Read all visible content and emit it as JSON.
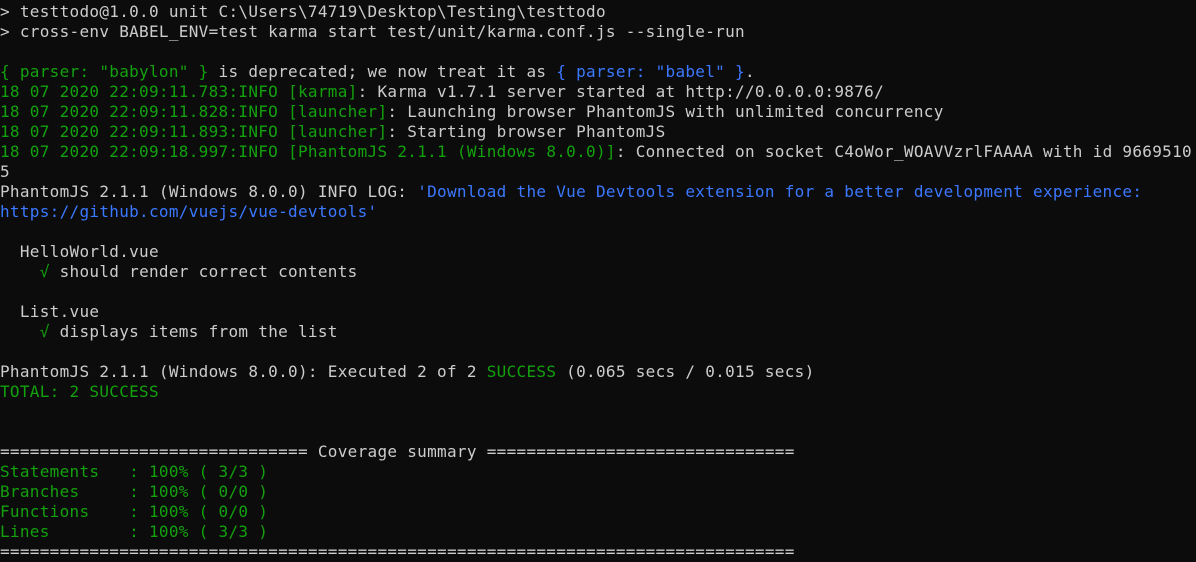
{
  "colors": {
    "background": "#0c0c0c",
    "text": "#cccccc",
    "green": "#13a10e",
    "blue": "#3b78ff"
  },
  "prompt": {
    "line1": "> testtodo@1.0.0 unit C:\\Users\\74719\\Desktop\\Testing\\testtodo",
    "line2": "> cross-env BABEL_ENV=test karma start test/unit/karma.conf.js --single-run"
  },
  "deprecation": {
    "open_brace": "{ parser: \"babylon\" }",
    "middle": " is deprecated; we now treat it as ",
    "new_value": "{ parser: \"babel\" }",
    "end": "."
  },
  "karma_logs": [
    {
      "timestamp": "18 07 2020 22:09:11.783:INFO ",
      "tag": "[karma]",
      "message": ": Karma v1.7.1 server started at http://0.0.0.0:9876/"
    },
    {
      "timestamp": "18 07 2020 22:09:11.828:INFO ",
      "tag": "[launcher]",
      "message": ": Launching browser PhantomJS with unlimited concurrency"
    },
    {
      "timestamp": "18 07 2020 22:09:11.893:INFO ",
      "tag": "[launcher]",
      "message": ": Starting browser PhantomJS"
    },
    {
      "timestamp": "18 07 2020 22:09:18.997:INFO ",
      "tag": "[PhantomJS 2.1.1 (Windows 8.0.0)]",
      "message": ": Connected on socket C4oWor_WOAVVzrlFAAAA with id 9669510"
    }
  ],
  "wrapped_id_tail": "5",
  "info_log": {
    "prefix": "PhantomJS 2.1.1 (Windows 8.0.0) INFO LOG: ",
    "message_part1": "'Download the Vue Devtools extension for a better development experience:",
    "message_part2": "https://github.com/vuejs/vue-devtools'"
  },
  "suites": [
    {
      "name": "  HelloWorld.vue",
      "check": "    √",
      "test": " should render correct contents"
    },
    {
      "name": "  List.vue",
      "check": "    √",
      "test": " displays items from the list"
    }
  ],
  "execution": {
    "prefix": "PhantomJS 2.1.1 (Windows 8.0.0): Executed 2 of 2 ",
    "status": "SUCCESS",
    "timing": " (0.065 secs / 0.015 secs)",
    "total": "TOTAL: 2 SUCCESS"
  },
  "coverage": {
    "header": "=============================== Coverage summary ===============================",
    "rows": [
      "Statements   : 100% ( 3/3 )",
      "Branches     : 100% ( 0/0 )",
      "Functions    : 100% ( 0/0 )",
      "Lines        : 100% ( 3/3 )"
    ],
    "footer": "================================================================================"
  }
}
